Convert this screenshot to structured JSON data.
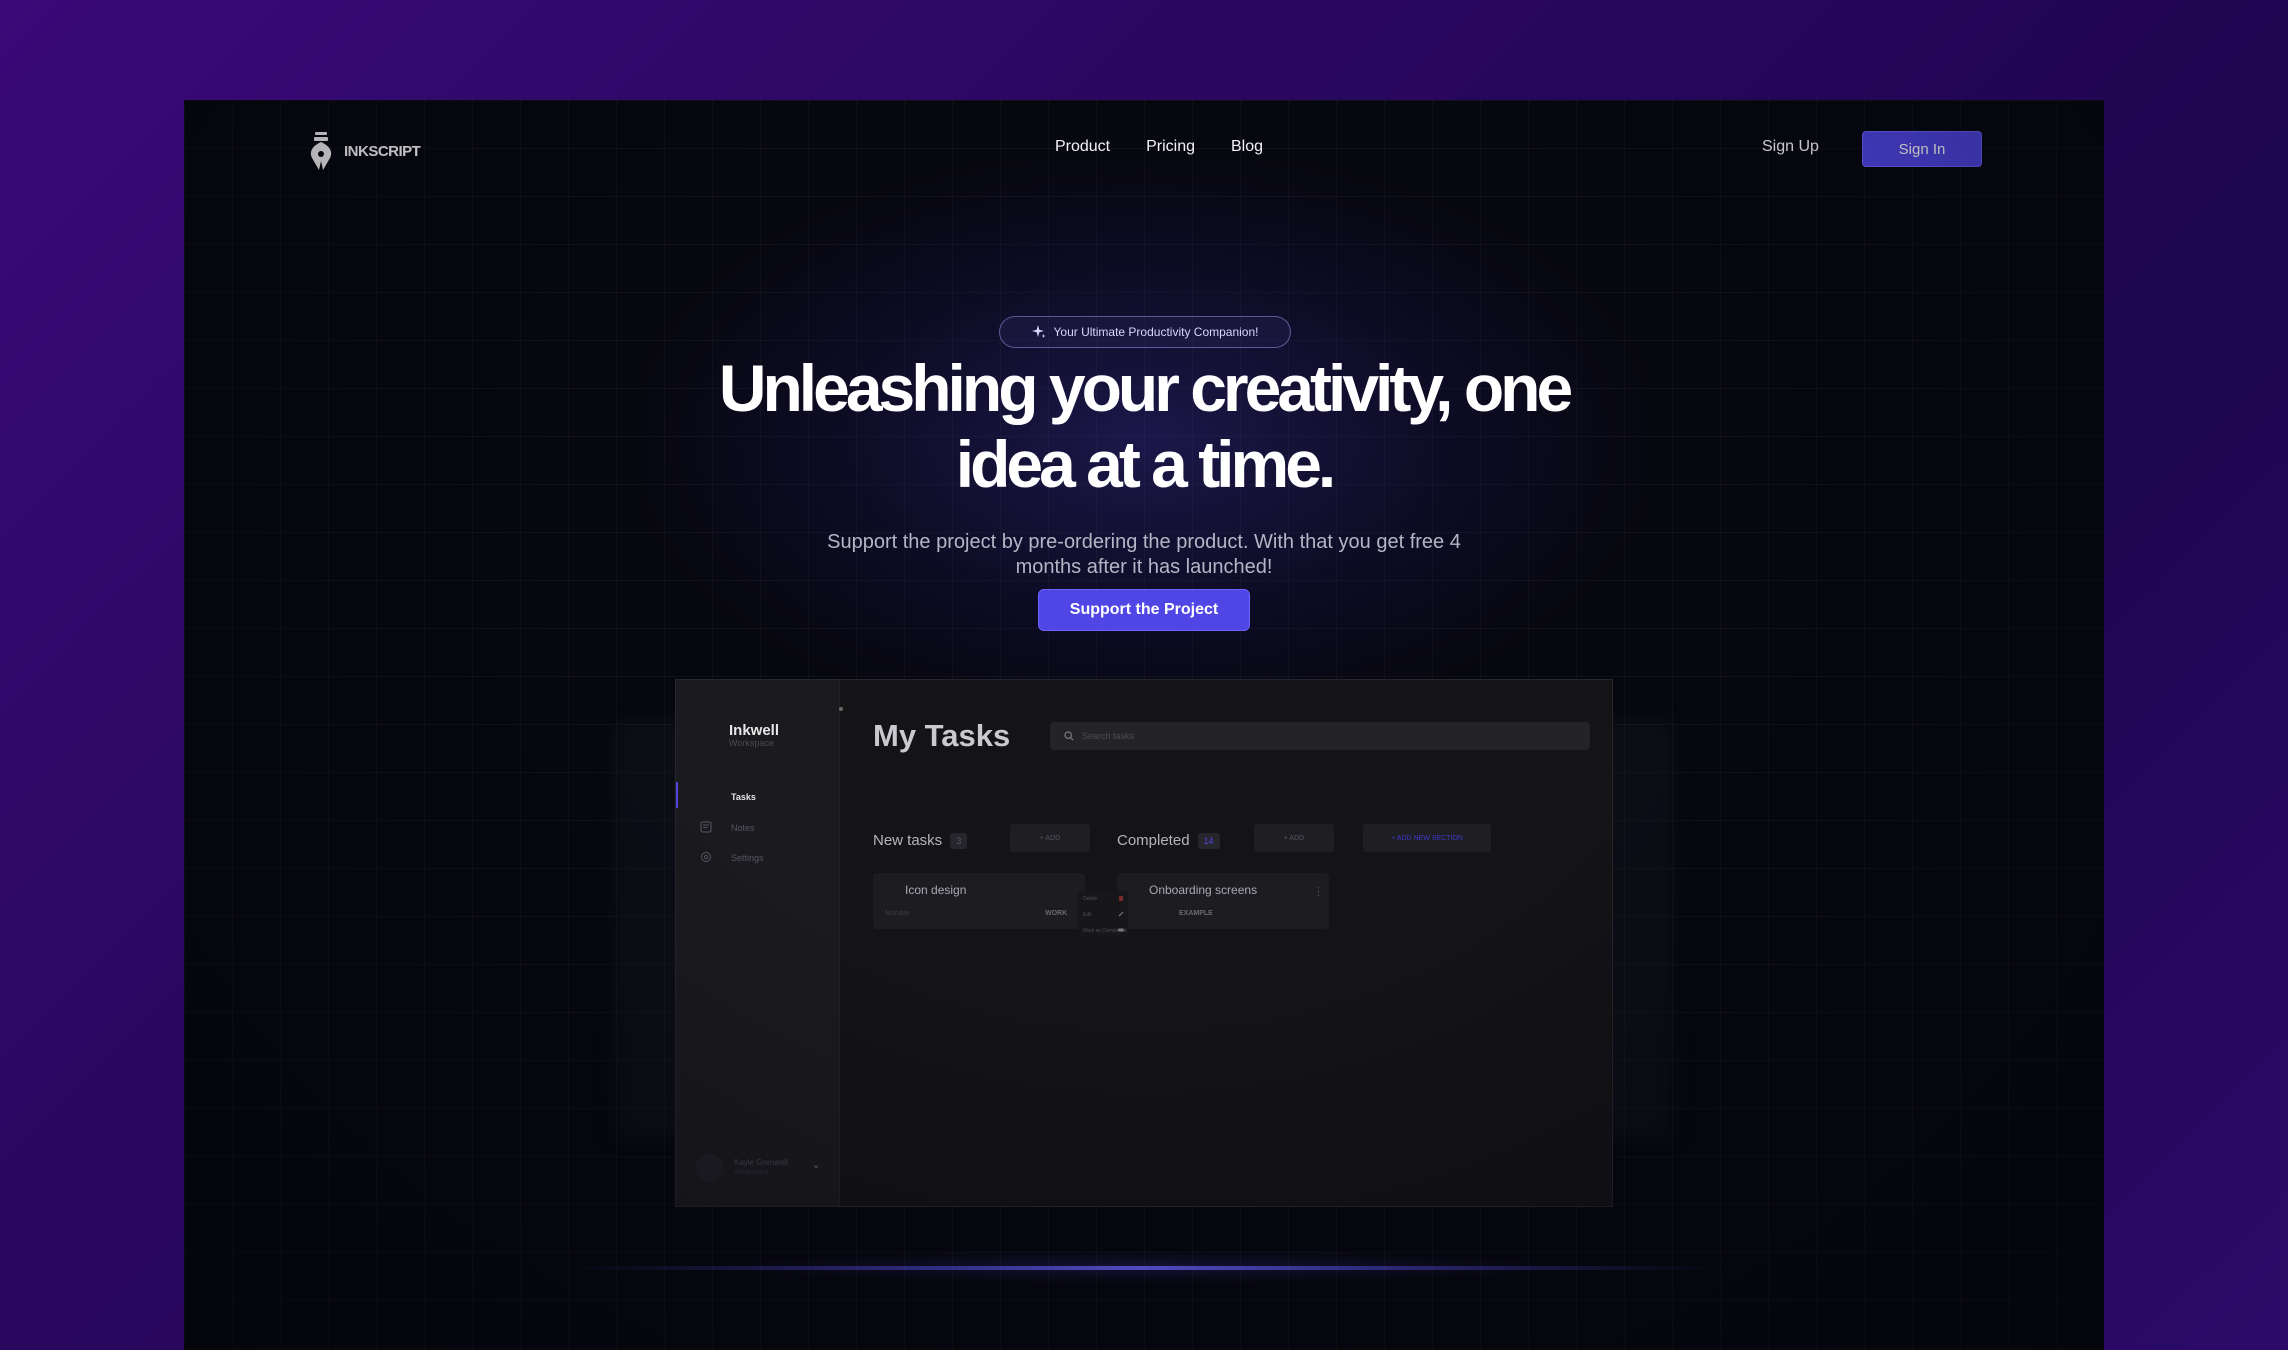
{
  "brand": {
    "name": "INKSCRIPT"
  },
  "nav": {
    "links": [
      "Product",
      "Pricing",
      "Blog"
    ],
    "sign_up": "Sign Up",
    "sign_in": "Sign In"
  },
  "hero": {
    "badge": "Your Ultimate Productivity Companion!",
    "headline_line1": "Unleashing your creativity, one",
    "headline_line2": "idea at a time.",
    "subtext": "Support the project by pre-ordering the product. With that you get free 4 months after it has launched!",
    "cta": "Support the Project"
  },
  "app": {
    "brand": "Inkwell",
    "brand_sub": "Workspace",
    "sidebar": [
      {
        "label": "Tasks",
        "icon": "tasks-icon",
        "active": true
      },
      {
        "label": "Notes",
        "icon": "notes-icon",
        "active": false
      },
      {
        "label": "Settings",
        "icon": "gear-icon",
        "active": false
      }
    ],
    "user": {
      "name": "Kayle Grenwall",
      "role": "Workspace"
    },
    "title": "My Tasks",
    "search_placeholder": "Search tasks",
    "sections": [
      {
        "title": "New tasks",
        "count": "3",
        "add": "+ ADD"
      },
      {
        "title": "Completed",
        "count": "14",
        "add": "+ ADD"
      }
    ],
    "add_section": "+ ADD NEW SECTION",
    "tasks": [
      {
        "title": "Icon design",
        "date": "Monday",
        "tag": "WORK"
      },
      {
        "title": "Onboarding screens",
        "tag": "EXAMPLE"
      }
    ],
    "context_menu": [
      "Delete",
      "Edit",
      "Mark as Completed"
    ]
  },
  "colors": {
    "accent": "#4f46e5",
    "frame_bg": "#07070f",
    "outer_bg": "#2a0760"
  }
}
